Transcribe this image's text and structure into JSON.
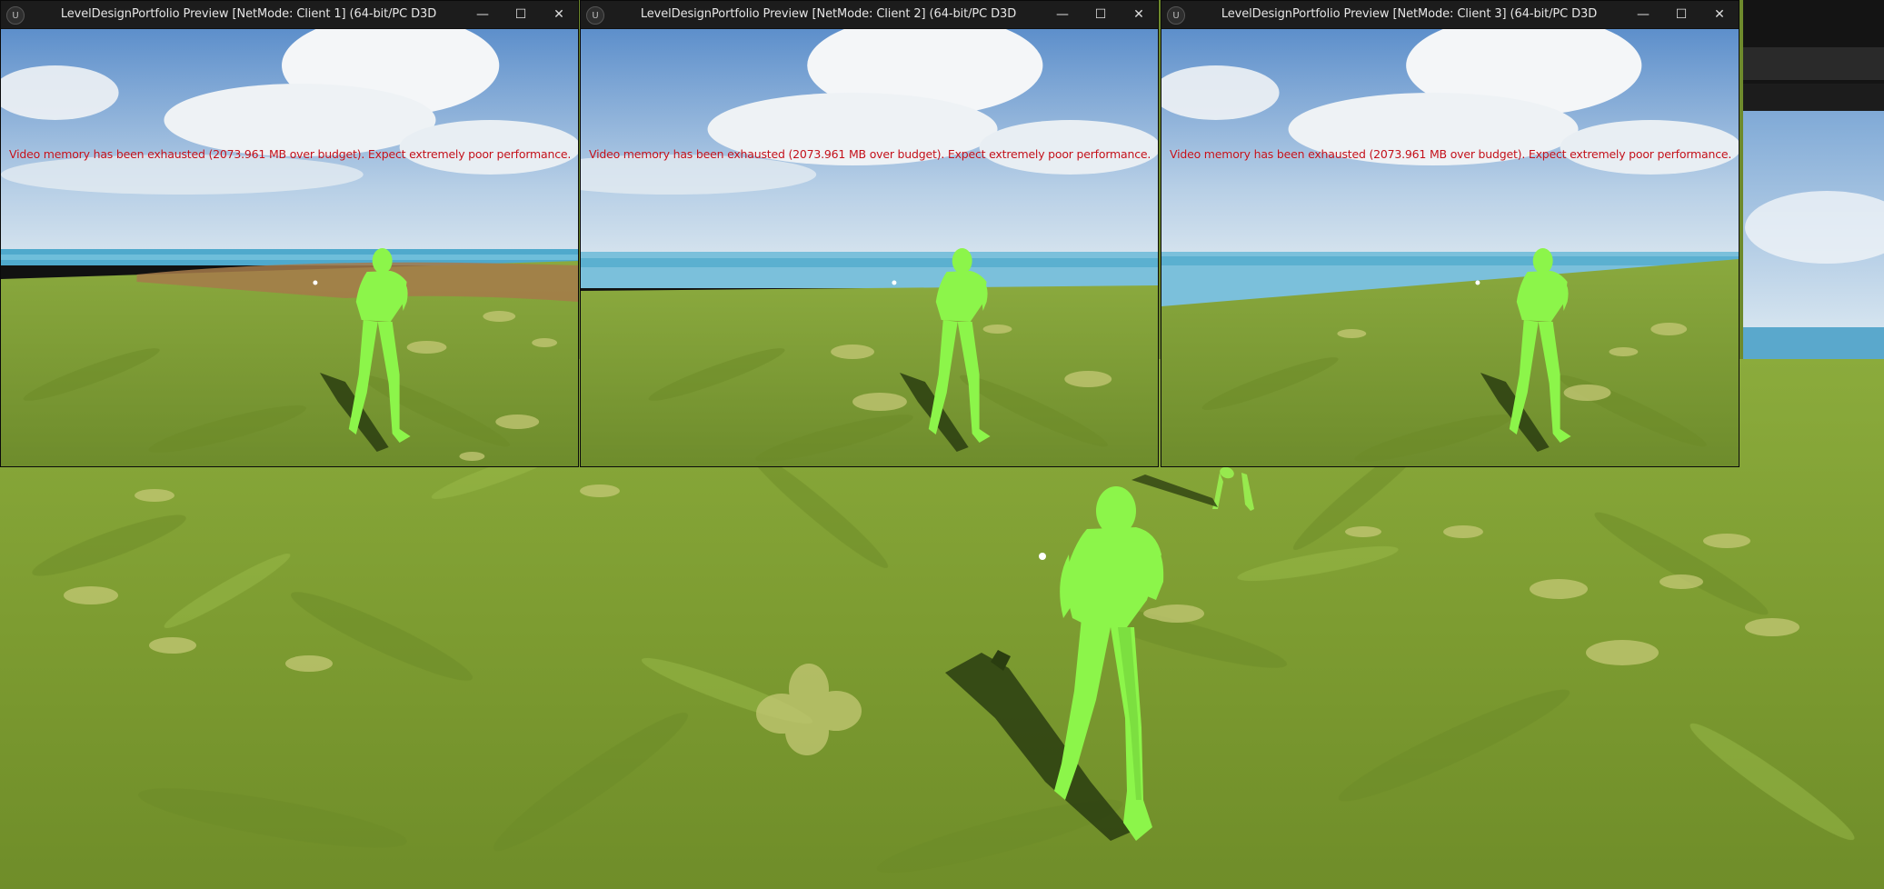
{
  "colors": {
    "grass": "#7c9a33",
    "grass_dark": "#5d7a22",
    "sky_top": "#6e9cd2",
    "sky_horizon": "#cfe0ee",
    "water": "#5ab4d3",
    "character": "#8cff44",
    "warning_text": "#c3101a",
    "titlebar": "#1c1c1c"
  },
  "clients": [
    {
      "title": "LevelDesignPortfolio Preview [NetMode: Client 1]  (64-bit/PC D3D",
      "warning": "Video memory has been exhausted (2073.961 MB over budget). Expect extremely poor performance."
    },
    {
      "title": "LevelDesignPortfolio Preview [NetMode: Client 2]  (64-bit/PC D3D",
      "warning": "Video memory has been exhausted (2073.961 MB over budget). Expect extremely poor performance."
    },
    {
      "title": "LevelDesignPortfolio Preview [NetMode: Client 3]  (64-bit/PC D3D",
      "warning": "Video memory has been exhausted (2073.961 MB over budget). Expect extremely poor performance."
    }
  ],
  "window_controls": {
    "minimize_glyph": "—",
    "maximize_glyph": "☐",
    "close_glyph": "✕"
  },
  "icons": {
    "app_logo": "unreal-engine-logo-icon"
  },
  "logo_text": "U"
}
